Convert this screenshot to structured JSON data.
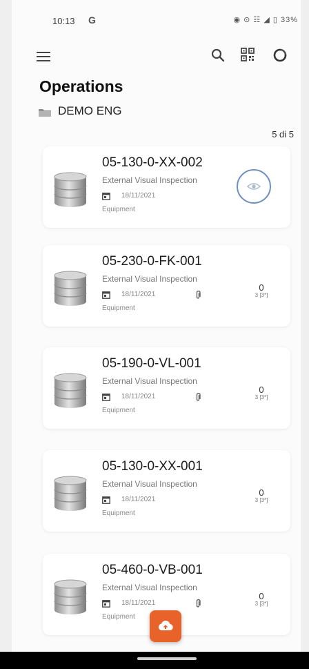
{
  "status_bar": {
    "time": "10:13",
    "carrier_icon": "G",
    "right_indicators": "◉ ⊙ ☷ ◢ ▯ 33%"
  },
  "app_bar": {
    "menu_icon": "hamburger-menu-icon",
    "actions": [
      "search-icon",
      "qr-code-icon",
      "refresh-icon"
    ]
  },
  "page": {
    "title": "Operations",
    "folder": "DEMO ENG",
    "counter": "5 di 5"
  },
  "operations": [
    {
      "code": "05-130-0-XX-002",
      "type": "External Visual Inspection",
      "date": "18/11/2021",
      "category": "Equipment",
      "has_attachment": false,
      "action": "eye-icon"
    },
    {
      "code": "05-230-0-FK-001",
      "type": "External Visual Inspection",
      "date": "18/11/2021",
      "category": "Equipment",
      "has_attachment": true,
      "count": "0",
      "count_sub": "3 [3*]"
    },
    {
      "code": "05-190-0-VL-001",
      "type": "External Visual Inspection",
      "date": "18/11/2021",
      "category": "Equipment",
      "has_attachment": true,
      "count": "0",
      "count_sub": "3 [3*]"
    },
    {
      "code": "05-130-0-XX-001",
      "type": "External Visual Inspection",
      "date": "18/11/2021",
      "category": "Equipment",
      "has_attachment": false,
      "count": "0",
      "count_sub": "3 [3*]"
    },
    {
      "code": "05-460-0-VB-001",
      "type": "External Visual Inspection",
      "date": "18/11/2021",
      "category": "Equipment",
      "has_attachment": true,
      "count": "0",
      "count_sub": "3 [3*]"
    }
  ],
  "fab": {
    "icon": "cloud-upload-icon"
  },
  "colors": {
    "accent": "#e8632a",
    "eye_ring": "#6d8fc0",
    "background": "#fbfbfb",
    "card": "#ffffff"
  }
}
